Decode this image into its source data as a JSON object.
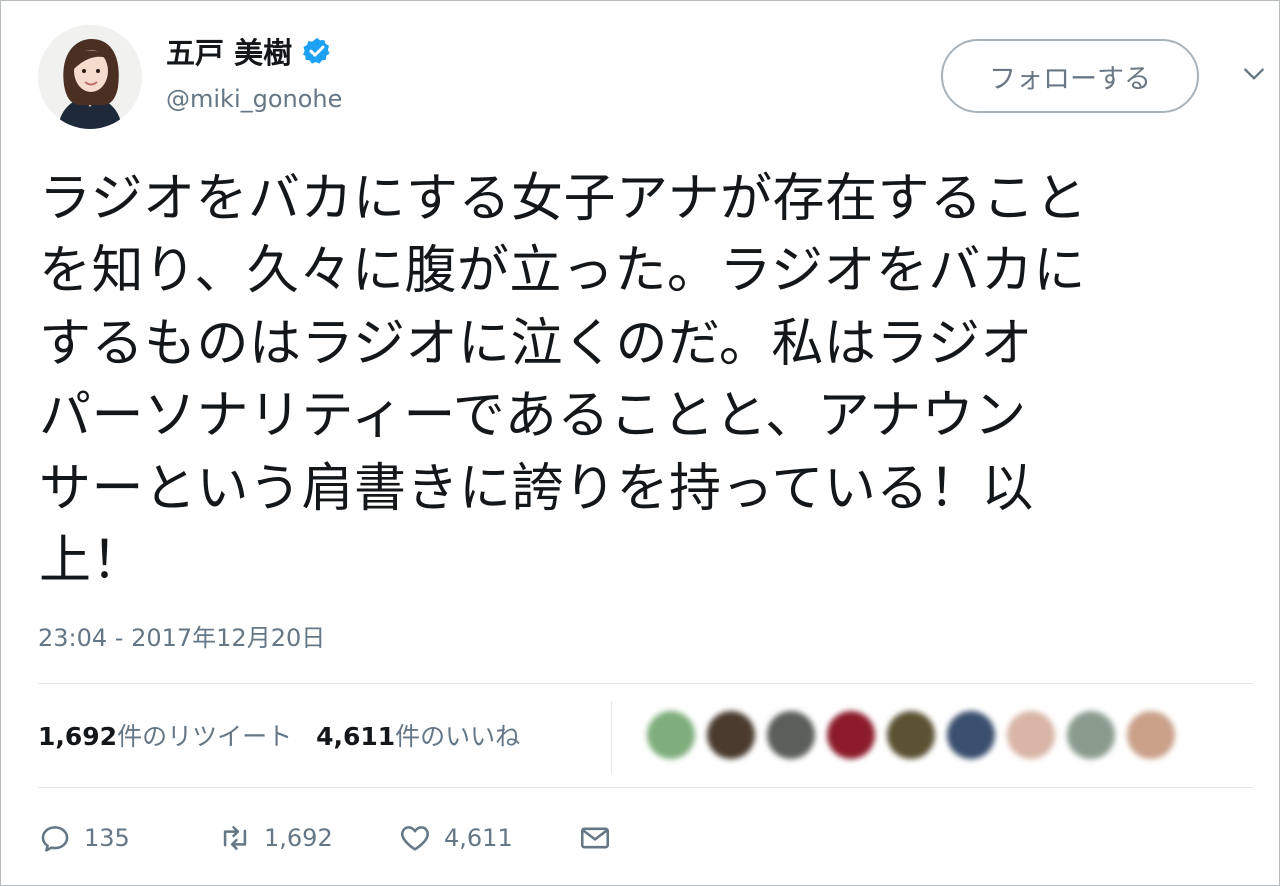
{
  "user": {
    "display_name": "五戸 美樹",
    "handle": "@miki_gonohe",
    "verified": true,
    "verified_color": "#1da1f2"
  },
  "follow_button": {
    "label": "フォローする"
  },
  "tweet": {
    "lines": [
      "ラジオをバカにする女子アナが存在すること",
      "を知り、久々に腹が立った。ラジオをバカに",
      "するものはラジオに泣くのだ。私はラジオ",
      "パーソナリティーであることと、アナウン",
      "サーという肩書きに誇りを持っている！以",
      "上！"
    ],
    "timestamp": "23:04 - 2017年12月20日"
  },
  "stats": {
    "retweets_count": "1,692",
    "retweets_label": "件のリツイート",
    "likes_count": "4,611",
    "likes_label": "件のいいね"
  },
  "liker_avatars": [
    {
      "icon": "blurred-avatar",
      "color": "#7fae7c"
    },
    {
      "icon": "blurred-avatar",
      "color": "#4a3b2e"
    },
    {
      "icon": "blurred-avatar",
      "color": "#5b5f5a"
    },
    {
      "icon": "blurred-avatar",
      "color": "#8c1c2c"
    },
    {
      "icon": "blurred-avatar",
      "color": "#5c5233"
    },
    {
      "icon": "blurred-avatar",
      "color": "#3b4f6e"
    },
    {
      "icon": "blurred-avatar",
      "color": "#d8b5a6"
    },
    {
      "icon": "blurred-avatar",
      "color": "#8a9b8e"
    },
    {
      "icon": "blurred-avatar",
      "color": "#caa089"
    }
  ],
  "actions": {
    "reply": {
      "icon": "reply-icon",
      "count": "135"
    },
    "retweet": {
      "icon": "retweet-icon",
      "count": "1,692"
    },
    "like": {
      "icon": "heart-icon",
      "count": "4,611"
    },
    "dm": {
      "icon": "envelope-icon"
    }
  }
}
